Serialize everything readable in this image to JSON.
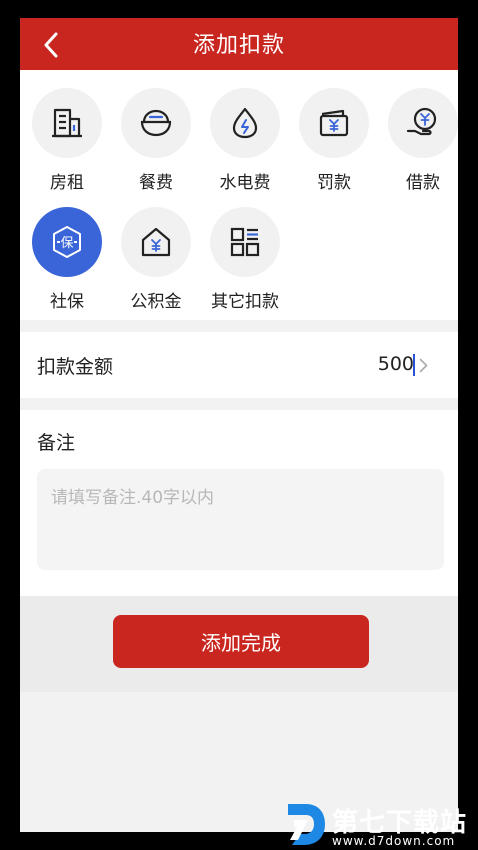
{
  "header": {
    "title": "添加扣款",
    "back_icon": "chevron-left-icon"
  },
  "categories": [
    {
      "label": "房租",
      "icon": "building-icon"
    },
    {
      "label": "餐费",
      "icon": "rice-bowl-icon"
    },
    {
      "label": "水电费",
      "icon": "water-drop-icon"
    },
    {
      "label": "罚款",
      "icon": "wallet-yen-icon"
    },
    {
      "label": "借款",
      "icon": "hand-yen-icon"
    },
    {
      "label": "社保",
      "icon": "shield-bao-icon",
      "selected": true,
      "icon_text": "保"
    },
    {
      "label": "公积金",
      "icon": "house-yen-icon"
    },
    {
      "label": "其它扣款",
      "icon": "grid-list-icon"
    }
  ],
  "amount": {
    "label": "扣款金额",
    "value": "500"
  },
  "remark": {
    "label": "备注",
    "placeholder": "请填写备注.40字以内",
    "value": ""
  },
  "submit": {
    "label": "添加完成"
  },
  "watermark": {
    "name": "第七下载站",
    "url": "www.d7down.com"
  },
  "colors": {
    "primary": "#c9261f",
    "selected": "#3a65d8",
    "background": "#f2f2f2"
  }
}
